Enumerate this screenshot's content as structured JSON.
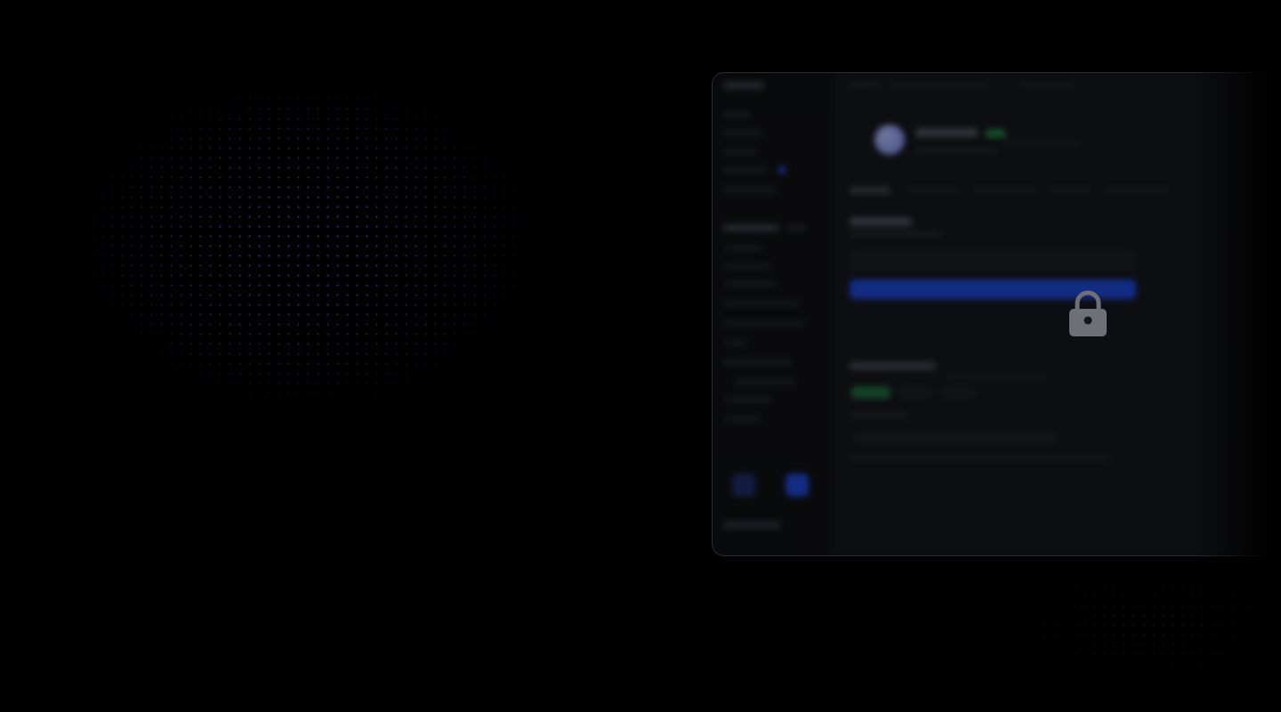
{
  "background": {
    "color": "#000000",
    "dot_color": "#2a3a9a"
  },
  "app_window": {
    "accent": "#1b45d8",
    "status_color": "#1f7a3d",
    "locked": true,
    "icon": "lock-icon"
  }
}
